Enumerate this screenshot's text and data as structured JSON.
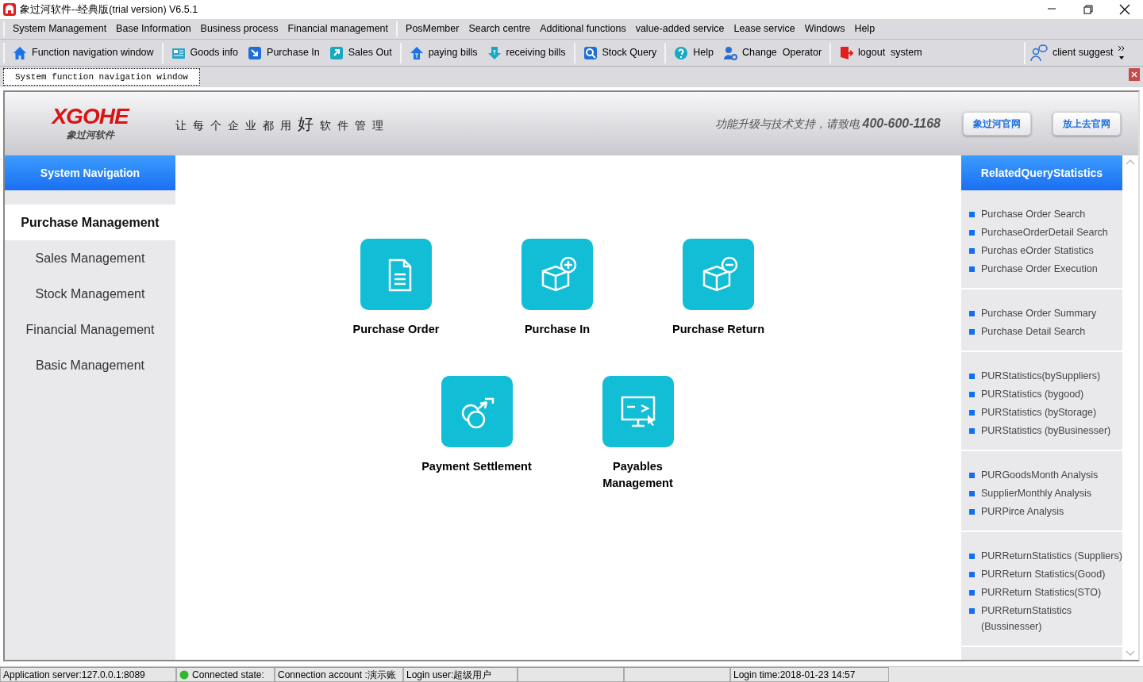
{
  "window": {
    "title": "象过河软件--经典版(trial version) V6.5.1"
  },
  "menu_groups": [
    [
      "System Management",
      "Base Information",
      "Business process",
      "Financial management"
    ],
    [
      "PosMember",
      "Search centre",
      "Additional functions",
      "value-added service",
      "Lease service",
      "Windows",
      "Help"
    ]
  ],
  "toolbar_groups": [
    [
      {
        "label": "Function navigation window",
        "kind": "home"
      }
    ],
    [
      {
        "label": "Goods info",
        "kind": "goods"
      },
      {
        "label": "Purchase In",
        "kind": "purchase"
      },
      {
        "label": "Sales Out",
        "kind": "sales"
      }
    ],
    [
      {
        "label": "paying bills",
        "kind": "paying"
      },
      {
        "label": "receiving bills",
        "kind": "receiving"
      }
    ],
    [
      {
        "label": "Stock Query",
        "kind": "query"
      }
    ],
    [
      {
        "label": "Help",
        "kind": "help"
      },
      {
        "label": "Change  Operator",
        "kind": "operator"
      }
    ],
    [
      {
        "label": "logout  system",
        "kind": "logout"
      }
    ]
  ],
  "toolbar_right": {
    "label": "client suggest",
    "kind": "suggest"
  },
  "tabs": [
    {
      "label": "System function navigation window",
      "selected": true
    }
  ],
  "header": {
    "logo": "XGOHE",
    "logo_sub": "象过河软件",
    "slogan": [
      "让每个企业都用",
      "好",
      "软件管理"
    ],
    "support": "功能升级与技术支持，请致电 **400-600-1168**",
    "buttons": [
      "象过河官网",
      "放上去官网"
    ]
  },
  "sidebar": {
    "title": "System Navigation",
    "items": [
      {
        "label": "Purchase Management",
        "selected": true
      },
      {
        "label": "Sales Management",
        "selected": false
      },
      {
        "label": "Stock Management",
        "selected": false
      },
      {
        "label": "Financial Management",
        "selected": false
      },
      {
        "label": "Basic Management",
        "selected": false
      }
    ]
  },
  "tiles": [
    [
      {
        "label": "Purchase Order",
        "kind": "document"
      },
      {
        "label": "Purchase In",
        "kind": "box-plus"
      },
      {
        "label": "Purchase Return",
        "kind": "box-minus"
      }
    ],
    [
      {
        "label": "Payment Settlement",
        "kind": "money"
      },
      {
        "label": "Payables Management",
        "kind": "monitor"
      }
    ]
  ],
  "related": {
    "title": "RelatedQueryStatistics",
    "groups": [
      [
        "Purchase Order Search",
        "PurchaseOrderDetail Search",
        "Purchas eOrder Statistics",
        "Purchase Order Execution"
      ],
      [
        "Purchase Order Summary",
        "Purchase Detail Search"
      ],
      [
        "PURStatistics(bySuppliers)",
        "PURStatistics (bygood)",
        "PURStatistics (byStorage)",
        "PURStatistics (byBusinesser)"
      ],
      [
        "PURGoodsMonth Analysis",
        "SupplierMonthly Analysis",
        "PURPirce Analysis"
      ],
      [
        "PURReturnStatistics (Suppliers)",
        "PURReturn Statistics(Good)",
        "PURReturn Statistics(STO)",
        "PURReturnStatistics (Bussinesser)"
      ]
    ]
  },
  "status_bar": [
    {
      "text": "Application server:127.0.0.1:8089",
      "kind": "text"
    },
    {
      "text": "Connected state:",
      "kind": "connected"
    },
    {
      "text": "Connection account :演示账",
      "kind": "text"
    },
    {
      "text": "Login user:超级用户",
      "kind": "text"
    },
    {
      "kind": "blank"
    },
    {
      "kind": "blank"
    },
    {
      "text": "Login time:2018-01-23 14:57",
      "kind": "text"
    }
  ]
}
